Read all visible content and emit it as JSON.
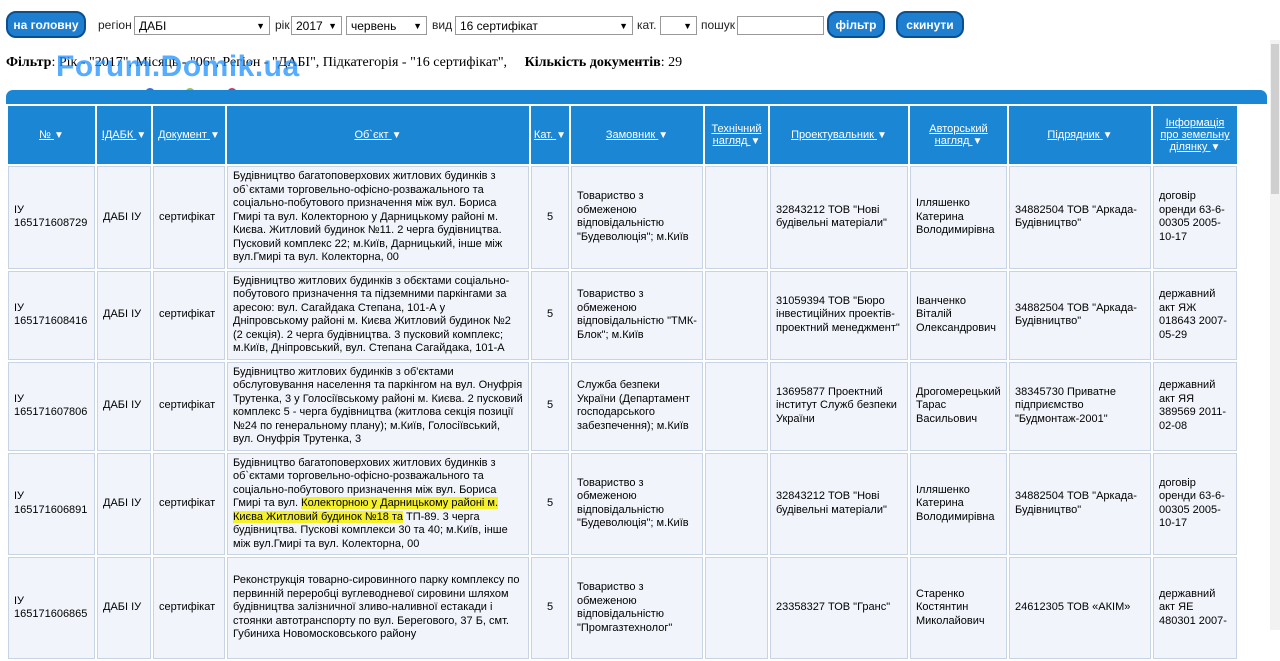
{
  "toolbar": {
    "home_label": "на головну",
    "region_label": "регіон",
    "region_value": "ДАБІ",
    "year_label": "рік",
    "year_value": "2017",
    "month_value": "червень",
    "type_label": "вид",
    "type_value": "16 сертифікат",
    "category_label": "кат.",
    "category_value": "",
    "search_label": "пошук",
    "search_value": "",
    "filter_label": "фільтр",
    "reset_label": "скинути"
  },
  "filter_info": {
    "prefix": "Фільтр",
    "text": ": Рік - \"2017\", Місяць - \"06\", Регіон - \"ДАБІ\", Підкатегорія - \"16 сертифікат\",",
    "count_label": "Кількість документів",
    "count_value": ": 29"
  },
  "watermark": "Forum.Domik.ua",
  "table": {
    "headers": [
      "№",
      "ІДАБК",
      "Документ",
      "Об`єкт",
      "Кат.",
      "Замовник",
      "Технічний нагляд",
      "Проектувальник",
      "Авторський нагляд",
      "Підрядник",
      "Інформація про земельну ділянку"
    ],
    "rows": [
      {
        "num": "ІУ 165171608729",
        "idabk": "ДАБІ ІУ",
        "doc": "сертифікат",
        "object": "Будівництво багатоповерхових житлових будинків з об`єктами торговельно-офісно-розважального та соціально-побутового призначення між вул. Бориса Гмирі та вул. Колекторною у Дарницькому районі м. Києва. Житловий будинок №11. 2 черга будівництва. Пусковий комплекс 22; м.Київ, Дарницький, інше між вул.Гмирі та вул. Колекторна, 00",
        "cat": "5",
        "customer": "Товариство з обмеженою відповідальністю \"Будеволюція\"; м.Київ",
        "tech": "",
        "designer": "32843212 ТОВ \"Нові будівельні матеріали\"",
        "author": "Ілляшенко Катерина Володимирівна",
        "contractor": "34882504 ТОВ \"Аркада-Будівництво\"",
        "land": "договір оренди 63-6-00305 2005-10-17"
      },
      {
        "num": "ІУ 165171608416",
        "idabk": "ДАБІ ІУ",
        "doc": "сертифікат",
        "object": "Будівництво житлових будинків з обєктами соціально-побутового призначення та підземними паркінгами за аресою: вул. Сагайдака Степана, 101-А у Дніпровському районі м. Києва Житловий будинок №2 (2 секція). 2 черга будівництва. 3 пусковий комплекс; м.Київ, Дніпровський, вул. Степана Сагайдака, 101-А",
        "cat": "5",
        "customer": "Товариство з обмеженою відповідальністю \"ТМК-Блок\"; м.Київ",
        "tech": "",
        "designer": "31059394 ТОВ \"Бюро інвестиційних проектів-проектний менеджмент\"",
        "author": "Іванченко Віталій Олександрович",
        "contractor": "34882504 ТОВ \"Аркада-Будівництво\"",
        "land": "державний акт ЯЖ 018643 2007-05-29"
      },
      {
        "num": "ІУ 165171607806",
        "idabk": "ДАБІ ІУ",
        "doc": "сертифікат",
        "object": "Будівництво житлових будинків з об'єктами обслуговування населення та паркінгом на вул. Онуфрія Трутенка, 3 у Голосіївському районі м. Києва. 2 пусковий комплекс 5 - черга будівництва (житлова секція позиції №24 по генеральному плану); м.Київ, Голосіївський, вул. Онуфрія Трутенка, 3",
        "cat": "5",
        "customer": "Служба безпеки України (Департамент господарського забезпечення); м.Київ",
        "tech": "",
        "designer": "13695877 Проектний інститут Служб безпеки України",
        "author": "Дрогомерецький Тарас Васильович",
        "contractor": "38345730 Приватне підприємство \"Будмонтаж-2001\"",
        "land": "державний акт ЯЯ 389569 2011-02-08"
      },
      {
        "num": "ІУ 165171606891",
        "idabk": "ДАБІ ІУ",
        "doc": "сертифікат",
        "object_pre": "Будівництво багатоповерхових житлових будинків з об`єктами торговельно-офісно-розважального та соціально-побутового призначення між вул. Бориса Гмирі та вул. ",
        "object_hl1": "Колекторною у Дарницькому районі м. ",
        "object_hl2": "Києва Житловий будинок №18 та",
        "object_post": " ТП-89. 3 черга будівництва. Пускові комплекси 30 та 40; м.Київ, інше між вул.Гмирі та вул. Колекторна, 00",
        "cat": "5",
        "customer": "Товариство з обмеженою відповідальністю \"Будеволюція\"; м.Київ",
        "tech": "",
        "designer": "32843212 ТОВ \"Нові будівельні матеріали\"",
        "author": "Ілляшенко Катерина Володимирівна",
        "contractor": "34882504 ТОВ \"Аркада-Будівництво\"",
        "land": "договір оренди 63-6-00305 2005-10-17"
      },
      {
        "num": "ІУ 165171606865",
        "idabk": "ДАБІ ІУ",
        "doc": "сертифікат",
        "object": "Реконструкція товарно-сировинного парку комплексу по первинній переробці вуглеводневої сировини шляхом будівництва залізничної зливо-наливної естакади і стоянки автотранспорту по вул. Берегового, 37 Б, смт. Губиниха Новомосковського району",
        "cat": "5",
        "customer": "Товариство з обмеженою відповідальністю \"Промгазтехнолог\"",
        "tech": "",
        "designer": "23358327 ТОВ \"Гранс\"",
        "author": "Старенко Костянтин Миколайович",
        "contractor": "24612305 ТОВ «АКІМ»",
        "land": "державний акт ЯЕ 480301 2007-"
      }
    ]
  },
  "colors": {
    "button_bg": "#1e7fd0",
    "header_bg": "#1a86d4",
    "cell_bg": "#f1f5fb",
    "highlight": "#f4f02c"
  }
}
